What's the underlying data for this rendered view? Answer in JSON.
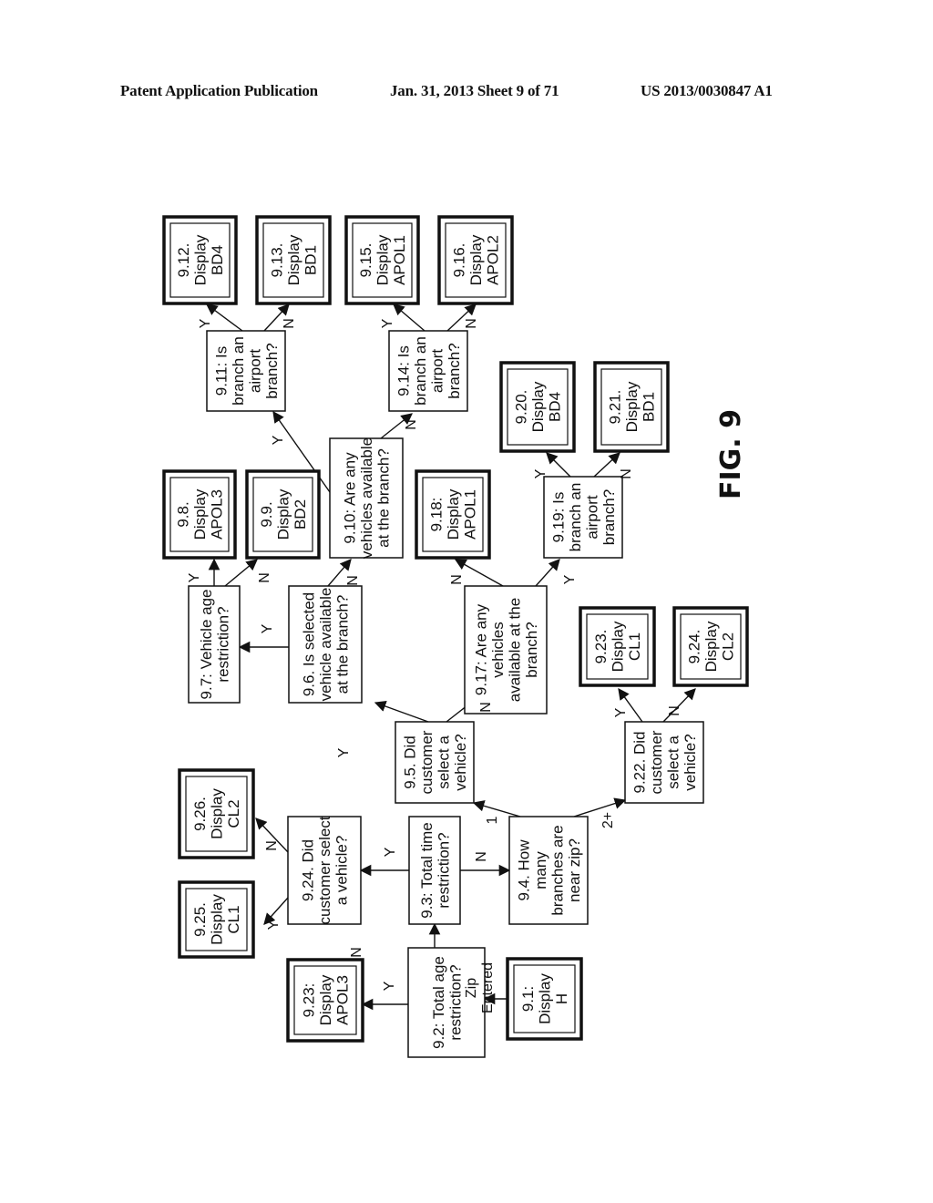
{
  "header": {
    "left": "Patent Application Publication",
    "middle": "Jan. 31, 2013   Sheet 9 of 71",
    "right": "US 2013/0030847 A1"
  },
  "figure_label": "FIG. 9",
  "nodes": {
    "n9_1": {
      "type": "display",
      "lines": [
        "9.1:",
        "Display",
        "H"
      ]
    },
    "n9_2": {
      "type": "decision",
      "lines": [
        "9.2: Total age",
        "restriction?"
      ]
    },
    "n9_23a": {
      "type": "display",
      "lines": [
        "9.23:",
        "Display",
        "APOL3"
      ]
    },
    "n9_3": {
      "type": "decision",
      "lines": [
        "9.3: Total time",
        "restriction?"
      ]
    },
    "n9_24a": {
      "type": "decision",
      "lines": [
        "9.24. Did",
        "customer select",
        "a vehicle?"
      ]
    },
    "n9_25": {
      "type": "display",
      "lines": [
        "9.25.",
        "Display",
        "CL1"
      ]
    },
    "n9_26": {
      "type": "display",
      "lines": [
        "9.26.",
        "Display",
        "CL2"
      ]
    },
    "n9_4": {
      "type": "decision",
      "lines": [
        "9.4. How",
        "many",
        "branches are",
        "near zip?"
      ]
    },
    "n9_5": {
      "type": "decision",
      "lines": [
        "9.5. Did",
        "customer",
        "select a",
        "vehicle?"
      ]
    },
    "n9_22": {
      "type": "decision",
      "lines": [
        "9.22. Did",
        "customer",
        "select a",
        "vehicle?"
      ]
    },
    "n9_23b": {
      "type": "display",
      "lines": [
        "9.23.",
        "Display",
        "CL1"
      ]
    },
    "n9_24b": {
      "type": "display",
      "lines": [
        "9.24.",
        "Display",
        "CL2"
      ]
    },
    "n9_6": {
      "type": "decision",
      "lines": [
        "9.6. Is selected",
        "vehicle available",
        "at the branch?"
      ]
    },
    "n9_7": {
      "type": "decision",
      "lines": [
        "9.7: Vehicle age",
        "restriction?"
      ]
    },
    "n9_8": {
      "type": "display",
      "lines": [
        "9.8.",
        "Display",
        "APOL3"
      ]
    },
    "n9_9": {
      "type": "display",
      "lines": [
        "9.9.",
        "Display",
        "BD2"
      ]
    },
    "n9_10": {
      "type": "decision",
      "lines": [
        "9.10: Are any",
        "vehicles available",
        "at the branch?"
      ]
    },
    "n9_11": {
      "type": "decision",
      "lines": [
        "9.11: Is",
        "branch an",
        "airport",
        "branch?"
      ]
    },
    "n9_12": {
      "type": "display",
      "lines": [
        "9.12.",
        "Display",
        "BD4"
      ]
    },
    "n9_13": {
      "type": "display",
      "lines": [
        "9.13.",
        "Display",
        "BD1"
      ]
    },
    "n9_14": {
      "type": "decision",
      "lines": [
        "9.14: Is",
        "branch an",
        "airport",
        "branch?"
      ]
    },
    "n9_15": {
      "type": "display",
      "lines": [
        "9.15.",
        "Display",
        "APOL1"
      ]
    },
    "n9_16": {
      "type": "display",
      "lines": [
        "9.16.",
        "Display",
        "APOL2"
      ]
    },
    "n9_17": {
      "type": "decision",
      "lines": [
        "9.17: Are any",
        "vehicles",
        "available at the",
        "branch?"
      ]
    },
    "n9_18": {
      "type": "display",
      "lines": [
        "9.18:",
        "Display",
        "APOL1"
      ]
    },
    "n9_19": {
      "type": "decision",
      "lines": [
        "9.19: Is",
        "branch an",
        "airport",
        "branch?"
      ]
    },
    "n9_20": {
      "type": "display",
      "lines": [
        "9.20.",
        "Display",
        "BD4"
      ]
    },
    "n9_21": {
      "type": "display",
      "lines": [
        "9.21.",
        "Display",
        "BD1"
      ]
    }
  },
  "edges": [
    {
      "from": "n9_1",
      "to": "n9_2",
      "label": "Zip Entered"
    },
    {
      "from": "n9_2",
      "to": "n9_23a",
      "label": "Y"
    },
    {
      "from": "n9_2",
      "to": "n9_3",
      "label": "N"
    },
    {
      "from": "n9_3",
      "to": "n9_24a",
      "label": "Y"
    },
    {
      "from": "n9_3",
      "to": "n9_4",
      "label": "N"
    },
    {
      "from": "n9_24a",
      "to": "n9_25",
      "label": "Y"
    },
    {
      "from": "n9_24a",
      "to": "n9_26",
      "label": "N"
    },
    {
      "from": "n9_4",
      "to": "n9_5",
      "label": "1"
    },
    {
      "from": "n9_4",
      "to": "n9_22",
      "label": "2+"
    },
    {
      "from": "n9_22",
      "to": "n9_23b",
      "label": "Y"
    },
    {
      "from": "n9_22",
      "to": "n9_24b",
      "label": "N"
    },
    {
      "from": "n9_5",
      "to": "n9_6",
      "label": "Y"
    },
    {
      "from": "n9_5",
      "to": "n9_17",
      "label": "N"
    },
    {
      "from": "n9_6",
      "to": "n9_7",
      "label": "Y"
    },
    {
      "from": "n9_6",
      "to": "n9_10",
      "label": "N"
    },
    {
      "from": "n9_7",
      "to": "n9_8",
      "label": "Y"
    },
    {
      "from": "n9_7",
      "to": "n9_9",
      "label": "N"
    },
    {
      "from": "n9_10",
      "to": "n9_11",
      "label": "Y"
    },
    {
      "from": "n9_10",
      "to": "n9_14",
      "label": "N"
    },
    {
      "from": "n9_11",
      "to": "n9_12",
      "label": "Y"
    },
    {
      "from": "n9_11",
      "to": "n9_13",
      "label": "N"
    },
    {
      "from": "n9_14",
      "to": "n9_15",
      "label": "Y"
    },
    {
      "from": "n9_14",
      "to": "n9_16",
      "label": "N"
    },
    {
      "from": "n9_17",
      "to": "n9_18",
      "label": "N"
    },
    {
      "from": "n9_17",
      "to": "n9_19",
      "label": "Y"
    },
    {
      "from": "n9_19",
      "to": "n9_20",
      "label": "Y"
    },
    {
      "from": "n9_19",
      "to": "n9_21",
      "label": "N"
    }
  ],
  "extra_labels": {
    "n9_23a_corner": "N"
  }
}
